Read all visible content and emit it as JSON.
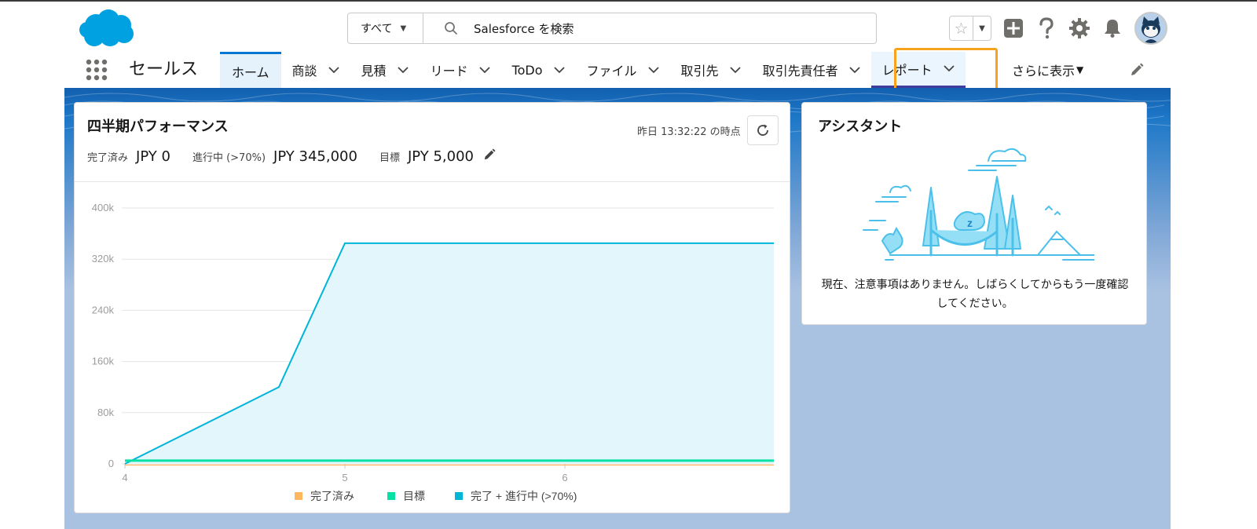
{
  "search": {
    "scope": "すべて",
    "placeholder": "Salesforce を検索"
  },
  "app": {
    "name": "セールス"
  },
  "nav": {
    "items": [
      {
        "label": "ホーム",
        "dropdown": false,
        "active": true
      },
      {
        "label": "商談",
        "dropdown": true
      },
      {
        "label": "見積",
        "dropdown": true
      },
      {
        "label": "リード",
        "dropdown": true
      },
      {
        "label": "ToDo",
        "dropdown": true
      },
      {
        "label": "ファイル",
        "dropdown": true
      },
      {
        "label": "取引先",
        "dropdown": true
      },
      {
        "label": "取引先責任者",
        "dropdown": true
      },
      {
        "label": "レポート",
        "dropdown": true,
        "highlighted": true
      }
    ],
    "more": "さらに表示"
  },
  "performance": {
    "title": "四半期パフォーマンス",
    "timestamp": "昨日 13:32:22 の時点",
    "closed_label": "完了済み",
    "closed_value": "JPY 0",
    "open_label": "進行中 (>70%)",
    "open_value": "JPY 345,000",
    "goal_label": "目標",
    "goal_value": "JPY 5,000"
  },
  "chart_data": {
    "type": "area",
    "x_ticks": [
      "4",
      "5",
      "6"
    ],
    "y_ticks": [
      "0",
      "80k",
      "160k",
      "240k",
      "320k",
      "400k"
    ],
    "ylim": [
      0,
      400000
    ],
    "xlim": [
      4,
      6.95
    ],
    "series": [
      {
        "name": "完了済み",
        "color": "#ffb75d",
        "points": [
          [
            4,
            0
          ],
          [
            6.95,
            0
          ]
        ]
      },
      {
        "name": "目標",
        "color": "#04e1a5",
        "points": [
          [
            4,
            5000
          ],
          [
            6.95,
            5000
          ]
        ]
      },
      {
        "name": "完了 + 進行中 (>70%)",
        "color": "#00b5d8",
        "points": [
          [
            4,
            0
          ],
          [
            4.7,
            120000
          ],
          [
            5,
            345000
          ],
          [
            6.95,
            345000
          ]
        ]
      }
    ],
    "legend": "bottom"
  },
  "assistant": {
    "title": "アシスタント",
    "message": "現在、注意事項はありません。しばらくしてからもう一度確認してください。",
    "sleep_letter": "z"
  },
  "colors": {
    "brand": "#0176d3",
    "highlight_outline": "#f8a31c",
    "report_underline": "#3f3d9e",
    "chart_line": "#00b5d8",
    "chart_fill": "#e3f6fb"
  }
}
